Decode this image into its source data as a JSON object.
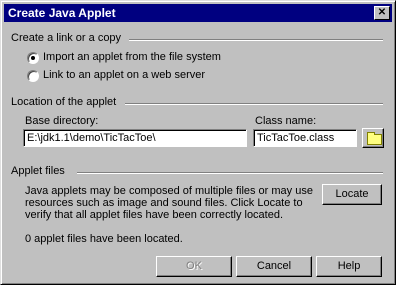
{
  "window": {
    "title": "Create Java Applet",
    "close_glyph": "✕"
  },
  "link_group": {
    "label": "Create a link or a copy",
    "options": [
      {
        "label": "Import an applet from the file system",
        "selected": true
      },
      {
        "label": "Link to an applet on a web server",
        "selected": false
      }
    ]
  },
  "location_group": {
    "label": "Location of the applet",
    "base_directory_label": "Base directory:",
    "base_directory_value": "E:\\jdk1.1\\demo\\TicTacToe\\",
    "class_name_label": "Class name:",
    "class_name_value": "TicTacToe.class",
    "browse_icon": "folder-icon"
  },
  "files_group": {
    "label": "Applet files",
    "description": "Java applets may be composed of multiple files or may use resources such as image and sound files. Click Locate to verify that all applet files have been correctly located.",
    "locate_label": "Locate",
    "status": "0 applet files have been located."
  },
  "buttons": {
    "ok": "OK",
    "cancel": "Cancel",
    "help": "Help"
  }
}
